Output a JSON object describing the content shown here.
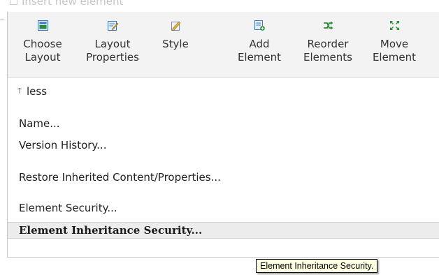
{
  "ghost_header": {
    "label": "Insert new element"
  },
  "toolbar": {
    "tools": [
      {
        "name": "choose-layout-button",
        "icon": "layout-grid-icon",
        "line1": "Choose",
        "line2": "Layout"
      },
      {
        "name": "layout-properties-button",
        "icon": "edit-document-icon",
        "line1": "Layout",
        "line2": "Properties"
      },
      {
        "name": "style-button",
        "icon": "pencil-style-icon",
        "line1": "Style",
        "line2": ""
      },
      {
        "name": "add-element-button",
        "icon": "add-element-icon",
        "line1": "Add",
        "line2": "Element"
      },
      {
        "name": "reorder-elements-button",
        "icon": "shuffle-icon",
        "line1": "Reorder",
        "line2": "Elements"
      },
      {
        "name": "move-element-button",
        "icon": "move-arrows-icon",
        "line1": "Move",
        "line2": "Element"
      }
    ]
  },
  "toggle": {
    "label": "less",
    "arrow": "⍑"
  },
  "menu": {
    "items": [
      {
        "label": "Name..."
      },
      {
        "label": "Version History..."
      },
      {
        "label": "Restore Inherited Content/Properties..."
      },
      {
        "label": "Element Security..."
      },
      {
        "label": "Element Inheritance Security..."
      }
    ]
  },
  "tooltip": {
    "text": "Element Inheritance Security."
  },
  "colors": {
    "toolbar_bg": "#f3f3f3",
    "active_row_bg": "#ececec",
    "tooltip_bg": "#ffffe1",
    "icon_blue": "#3a78c3",
    "icon_green": "#2e8b3a"
  }
}
